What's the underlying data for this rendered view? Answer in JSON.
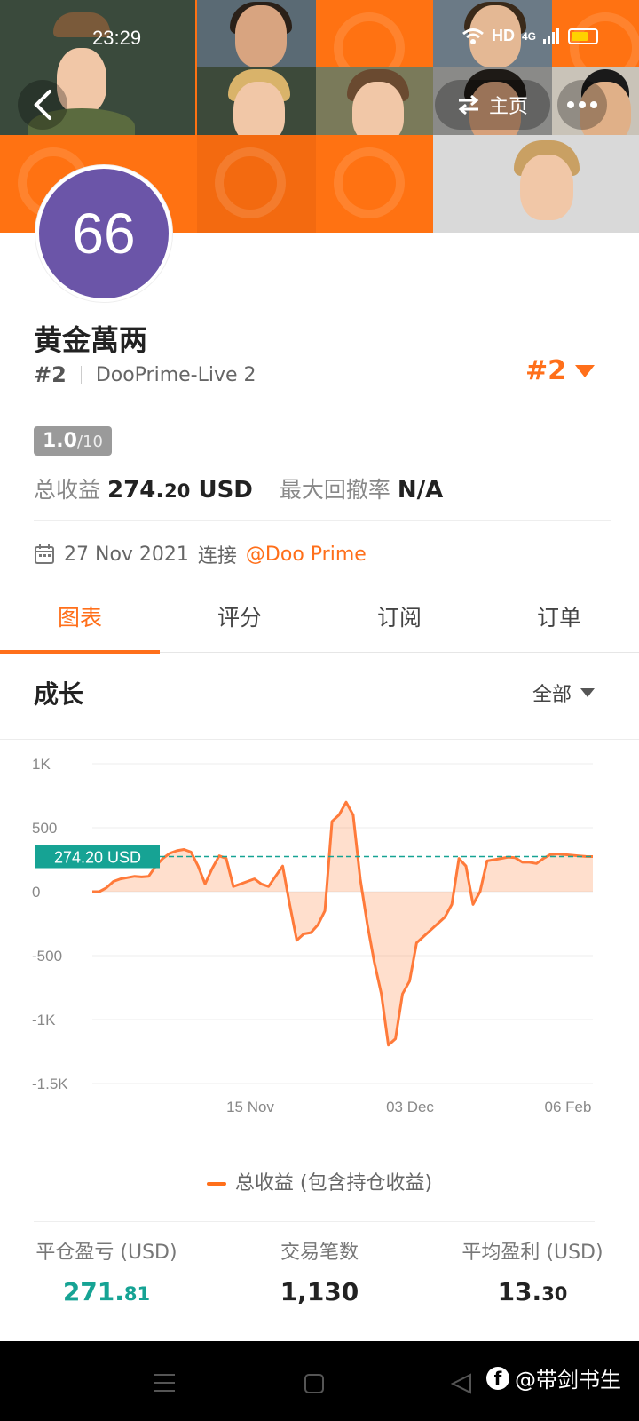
{
  "status_bar": {
    "time": "23:29",
    "network": "HD",
    "signal": "4G"
  },
  "header": {
    "home_label": "主页"
  },
  "profile": {
    "avatar_text": "66",
    "name": "黄金萬两",
    "rank": "#2",
    "account": "DooPrime-Live 2",
    "rank_right": "#2",
    "score_main": "1.0",
    "score_total": "/10",
    "total_profit_label": "总收益",
    "total_profit_int": "274.",
    "total_profit_dec": "20",
    "total_profit_unit": "USD",
    "drawdown_label": "最大回撤率",
    "drawdown_value": "N/A",
    "connect_date": "27 Nov 2021",
    "connect_label": "连接",
    "broker_link": "@Doo Prime"
  },
  "tabs": [
    {
      "label": "图表",
      "active": true
    },
    {
      "label": "评分",
      "active": false
    },
    {
      "label": "订阅",
      "active": false
    },
    {
      "label": "订单",
      "active": false
    }
  ],
  "section": {
    "title": "成长",
    "range": "全部"
  },
  "chart_data": {
    "type": "area",
    "y_ticks": [
      "1K",
      "500",
      "0",
      "-500",
      "-1K",
      "-1.5K"
    ],
    "x_ticks": [
      "15 Nov",
      "03 Dec",
      "06 Feb"
    ],
    "ylim": [
      -1500,
      1000
    ],
    "current_label": "274.20 USD",
    "current_value": 274.2,
    "series": [
      {
        "name": "总收益 (包含持仓收益)",
        "values": [
          0,
          0,
          30,
          80,
          100,
          110,
          120,
          115,
          120,
          200,
          260,
          300,
          320,
          330,
          310,
          200,
          60,
          180,
          280,
          260,
          40,
          60,
          80,
          100,
          60,
          40,
          120,
          200,
          -100,
          -380,
          -330,
          -320,
          -260,
          -150,
          550,
          600,
          700,
          600,
          100,
          -250,
          -550,
          -800,
          -1200,
          -1150,
          -800,
          -700,
          -400,
          -350,
          -300,
          -250,
          -200,
          -100,
          260,
          200,
          -100,
          0,
          240,
          250,
          260,
          270,
          265,
          230,
          230,
          220,
          260,
          290,
          295,
          290,
          285,
          280,
          275,
          274.2
        ]
      }
    ],
    "grid": true
  },
  "legend_label": "总收益 (包含持仓收益)",
  "metrics": [
    {
      "label": "平仓盈亏 (USD)",
      "int": "271.",
      "dec": "81",
      "color": "#16a394"
    },
    {
      "label": "交易笔数",
      "int": "1,130",
      "dec": "",
      "color": "#222222"
    },
    {
      "label": "平均盈利 (USD)",
      "int": "13.",
      "dec": "30",
      "color": "#222222"
    }
  ],
  "watermark": "@带剑书生",
  "colors": {
    "accent": "#ff6f1a",
    "avatar": "#6b55a8",
    "green": "#16a394"
  }
}
